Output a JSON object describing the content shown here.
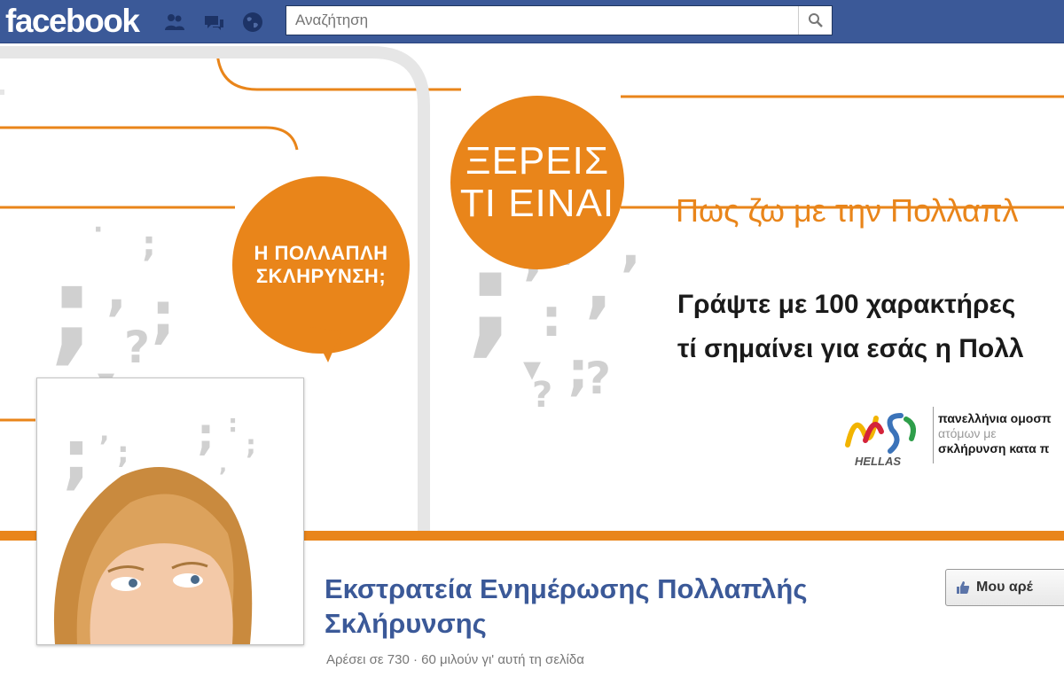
{
  "topbar": {
    "logo": "facebook",
    "search_placeholder": "Αναζήτηση",
    "icons": [
      "friend-requests-icon",
      "messages-icon",
      "notifications-globe-icon",
      "search-icon"
    ]
  },
  "cover": {
    "circle_top": [
      "ΞΕΡΕΙΣ",
      "ΤΙ ΕΙΝΑΙ"
    ],
    "circle_left": [
      "Η ΠΟΛΛΑΠΛΗ",
      "ΣΚΛΗΡΥΝΣΗ;"
    ],
    "headline": "Πως ζω με την Πολλαπλ",
    "prompt_line1": "Γράψτε με 100 χαρακτήρες",
    "prompt_line2": "τί σημαίνει για εσάς η Πολλ",
    "org_logo": {
      "letters": "MS",
      "sub": "HELLAS"
    },
    "org_text": [
      "πανελλήνια ομοσπ",
      "ατόμων με",
      "σκλήρυνση κατα π"
    ]
  },
  "page": {
    "name": "Εκστρατεία Ενημέρωσης Πολλαπλής Σκλήρυνσης",
    "likes_line": "Αρέσει σε 730 · 60 μιλούν γι' αυτή τη σελίδα",
    "like_button": "Μου αρέ"
  },
  "colors": {
    "facebook_blue": "#3b5998",
    "campaign_orange": "#e9851a",
    "punctuation_gray": "#d0d0d0"
  }
}
